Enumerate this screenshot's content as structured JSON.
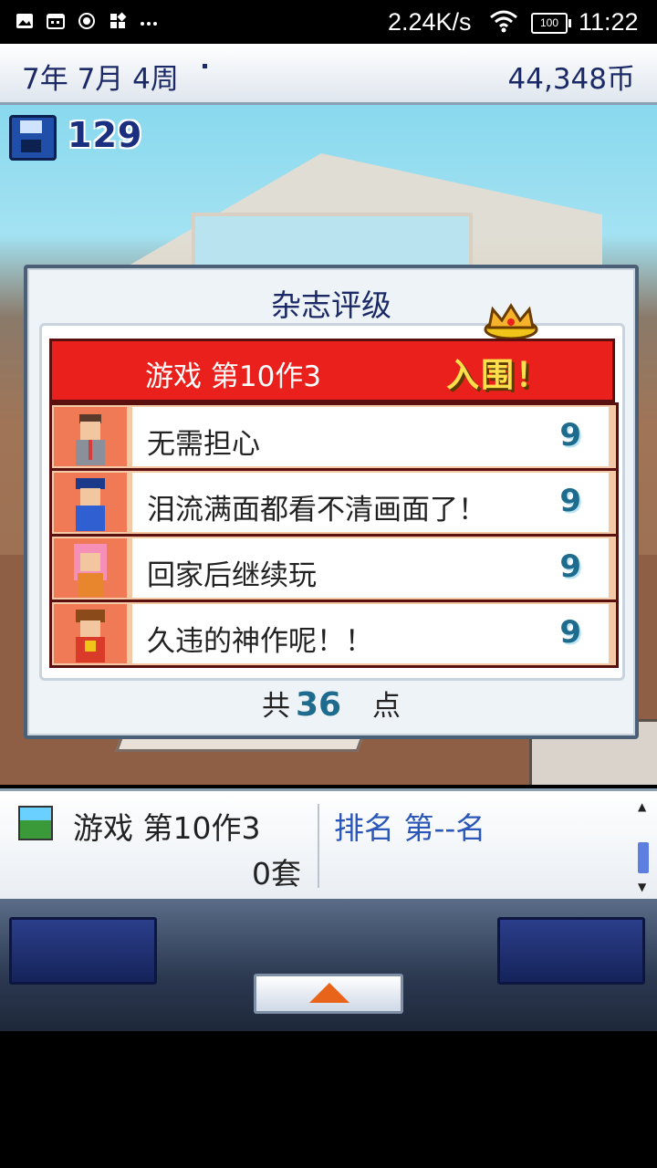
{
  "status_bar": {
    "net_speed": "2.24K/s",
    "battery": "100",
    "time": "11:22"
  },
  "top_bar": {
    "date": "7年 7月 4周",
    "money": "44,348币"
  },
  "save_count": "129",
  "dialog": {
    "title": "杂志评级",
    "game_name": "游戏 第10作3",
    "badge": "入围！",
    "reviews": [
      {
        "comment": "无需担心",
        "score": "9"
      },
      {
        "comment": "泪流满面都看不清画面了！",
        "score": "9"
      },
      {
        "comment": "回家后继续玩",
        "score": "9"
      },
      {
        "comment": "久违的神作呢！！",
        "score": "9"
      }
    ],
    "total_prefix": "共",
    "total_score": "36",
    "total_suffix": "点"
  },
  "info_panel": {
    "game_name": "游戏 第10作3",
    "units": "0套",
    "rank": "排名 第--名"
  },
  "colors": {
    "header_red": "#e9201b",
    "score_blue": "#1e6b8e",
    "text_navy": "#1b2a66"
  }
}
